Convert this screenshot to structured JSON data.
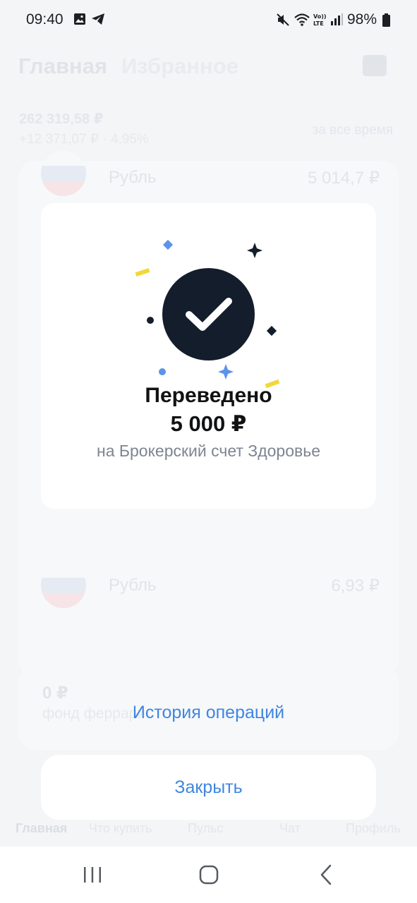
{
  "status_bar": {
    "time": "09:40",
    "battery": "98%",
    "icons": [
      "gallery-icon",
      "telegram-icon",
      "mute-icon",
      "wifi-call-icon",
      "volte-icon",
      "signal-icon",
      "battery-icon"
    ]
  },
  "background": {
    "tabs": [
      "Главная",
      "Избранное"
    ],
    "total": "262 319,58 ₽",
    "change": "+12 371,07 ₽ · 4,95%",
    "period": "за все время",
    "rows": [
      {
        "label": "Рубль",
        "value": "5 014,7 ₽"
      },
      {
        "label": "Рубль",
        "value": "6,93 ₽"
      }
    ],
    "fund": {
      "value": "0 ₽",
      "label": "фонд феррари"
    },
    "bottom_tabs": [
      "Главная",
      "Что купить",
      "Пульс",
      "Чат",
      "Профиль"
    ]
  },
  "modal": {
    "title": "Переведено",
    "amount": "5 000 ₽",
    "subtitle": "на Брокерский счет Здоровье",
    "colors": {
      "circle": "#141d2b",
      "accent_blue": "#5b94e8",
      "accent_yellow": "#f2d73a"
    }
  },
  "actions": {
    "history": "История операций",
    "close": "Закрыть",
    "link_color": "#3f86e0"
  },
  "nav": {
    "icons": [
      "recent-apps-icon",
      "home-icon",
      "back-icon"
    ]
  }
}
